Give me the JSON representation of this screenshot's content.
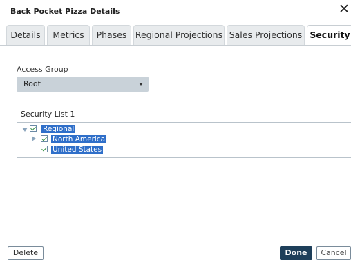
{
  "dialog": {
    "title": "Back Pocket Pizza Details",
    "close_glyph": "✕"
  },
  "tabs": [
    {
      "label": "Details"
    },
    {
      "label": "Metrics"
    },
    {
      "label": "Phases"
    },
    {
      "label": "Regional Projections"
    },
    {
      "label": "Sales Projections"
    },
    {
      "label": "Security",
      "active": true
    }
  ],
  "access_group": {
    "label": "Access Group",
    "selected": "Root"
  },
  "security_list": {
    "title": "Security List 1",
    "nodes": [
      {
        "label": "Regional",
        "checked": true,
        "expanded": true
      },
      {
        "label": "North America",
        "checked": true,
        "expanded": false
      },
      {
        "label": "United States",
        "checked": true
      }
    ]
  },
  "buttons": {
    "delete": "Delete",
    "done": "Done",
    "cancel": "Cancel"
  },
  "colors": {
    "primary": "#1e3f5a",
    "selection": "#2f6fc9",
    "check": "#2e8b3d"
  }
}
